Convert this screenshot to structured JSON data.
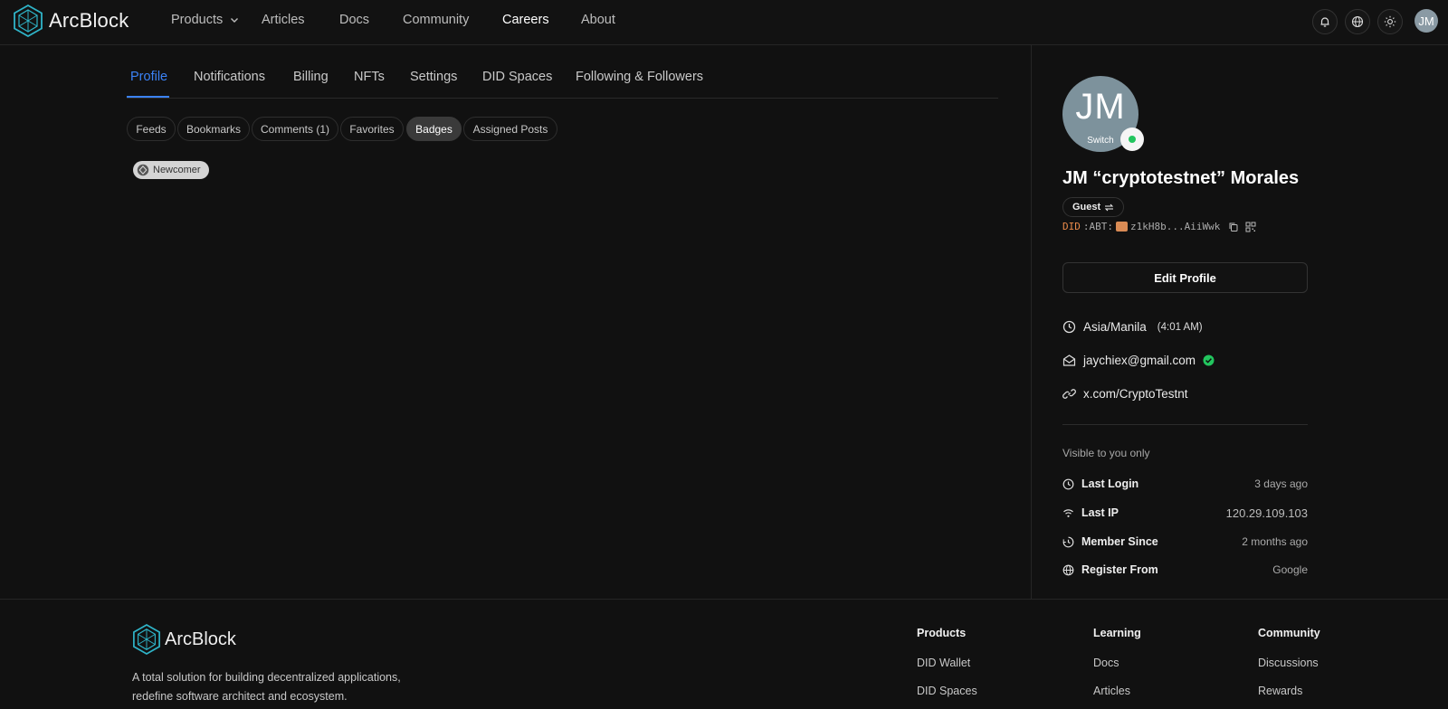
{
  "header": {
    "brand": "ArcBlock",
    "nav": [
      {
        "label": "Products",
        "has_dropdown": true
      },
      {
        "label": "Articles"
      },
      {
        "label": "Docs"
      },
      {
        "label": "Community"
      },
      {
        "label": "Careers",
        "active": true
      },
      {
        "label": "About"
      }
    ],
    "icons": [
      "bell-icon",
      "globe-icon",
      "sun-icon"
    ],
    "avatar_initials": "JM"
  },
  "tabs": [
    {
      "label": "Profile",
      "active": true
    },
    {
      "label": "Notifications"
    },
    {
      "label": "Billing"
    },
    {
      "label": "NFTs"
    },
    {
      "label": "Settings"
    },
    {
      "label": "DID Spaces"
    },
    {
      "label": "Following & Followers"
    }
  ],
  "subtabs": [
    {
      "label": "Feeds"
    },
    {
      "label": "Bookmarks"
    },
    {
      "label": "Comments (1)"
    },
    {
      "label": "Favorites"
    },
    {
      "label": "Badges",
      "active": true
    },
    {
      "label": "Assigned Posts"
    }
  ],
  "badges": [
    {
      "label": "Newcomer"
    }
  ],
  "profile": {
    "avatar_initials": "JM",
    "switch_label": "Switch",
    "name": "JM “cryptotestnet” Morales",
    "role": "Guest",
    "did_prefix": "DID",
    "did_chain": ":ABT:",
    "did_value": "z1kH8b...AiiWwk",
    "edit_button": "Edit Profile",
    "timezone": "Asia/Manila",
    "local_time": "(4:01 AM)",
    "email": "jaychiex@gmail.com",
    "link": "x.com/CryptoTestnt",
    "visible_note": "Visible to you only",
    "stats": [
      {
        "label": "Last Login",
        "value": "3 days ago",
        "icon": "clock-icon"
      },
      {
        "label": "Last IP",
        "value": "120.29.109.103",
        "icon": "wifi-icon"
      },
      {
        "label": "Member Since",
        "value": "2 months ago",
        "icon": "history-icon"
      },
      {
        "label": "Register From",
        "value": "Google",
        "icon": "globe-icon"
      }
    ]
  },
  "footer": {
    "brand": "ArcBlock",
    "tagline": "A total solution for building decentralized applications, redefine software architect and ecosystem.",
    "columns": [
      {
        "title": "Products",
        "links": [
          "DID Wallet",
          "DID Spaces"
        ]
      },
      {
        "title": "Learning",
        "links": [
          "Docs",
          "Articles"
        ]
      },
      {
        "title": "Community",
        "links": [
          "Discussions",
          "Rewards"
        ]
      }
    ]
  },
  "colors": {
    "accent": "#3b82f6",
    "online": "#22c55e",
    "did_prefix": "#e98a4a",
    "logo": "#2fb4c8"
  }
}
